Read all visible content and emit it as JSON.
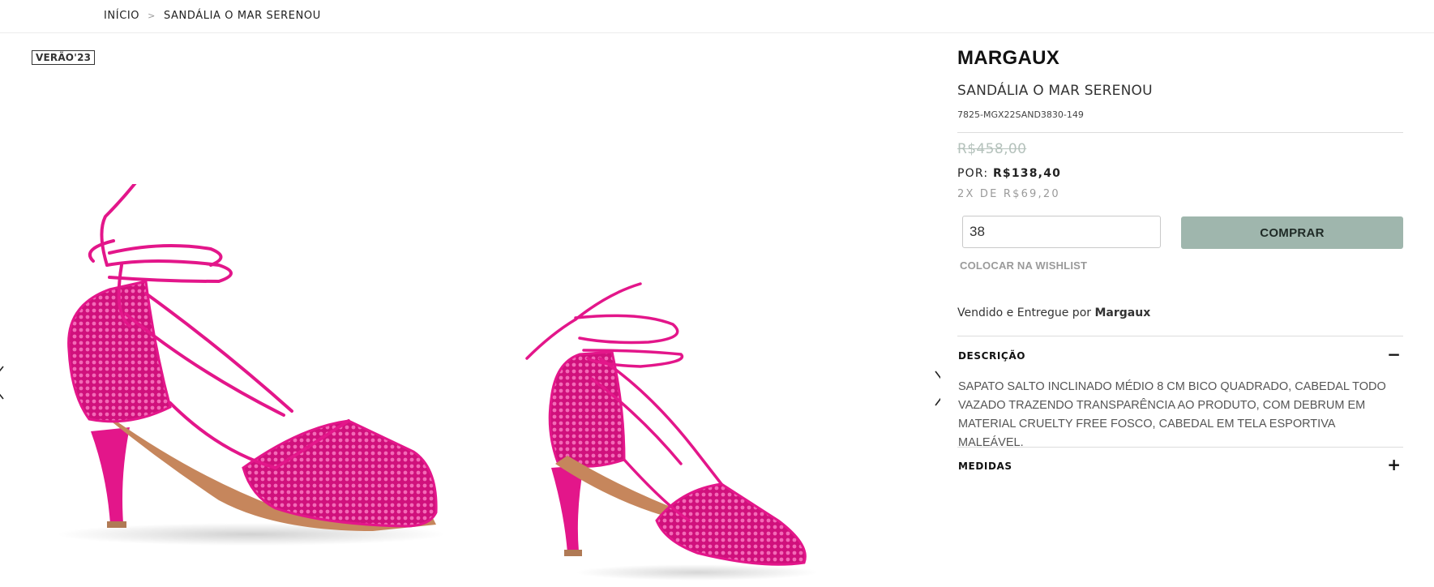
{
  "breadcrumb": {
    "home": "INÍCIO",
    "separator": ">",
    "current": "SANDÁLIA O MAR SERENOU"
  },
  "gallery": {
    "badge": "VERÃO'23",
    "prev_icon": "chevron-left-icon",
    "next_icon": "chevron-right-icon",
    "shoe_color": "#e3168a"
  },
  "product": {
    "brand": "MARGAUX",
    "name": "SANDÁLIA O MAR SERENOU",
    "sku": "7825-MGX22SAND3830-149",
    "old_price": "R$458,00",
    "price_prefix": "POR:",
    "price": "R$138,40",
    "installments": "2X DE R$69,20",
    "size_value": "38",
    "buy_label": "COMPRAR",
    "buy_color": "#9fb6ad",
    "wishlist_label": "COLOCAR NA WISHLIST",
    "seller_prefix": "Vendido e Entregue por",
    "seller_name": "Margaux"
  },
  "accordion": {
    "description": {
      "title": "DESCRIÇÃO",
      "toggle": "−",
      "text": "SAPATO SALTO INCLINADO MÉDIO 8 CM BICO QUADRADO, CABEDAL TODO VAZADO TRAZENDO TRANSPARÊNCIA AO PRODUTO, COM DEBRUM EM MATERIAL CRUELTY FREE FOSCO, CABEDAL EM TELA ESPORTIVA MALEÁVEL."
    },
    "measures": {
      "title": "MEDIDAS",
      "toggle": "+"
    }
  }
}
